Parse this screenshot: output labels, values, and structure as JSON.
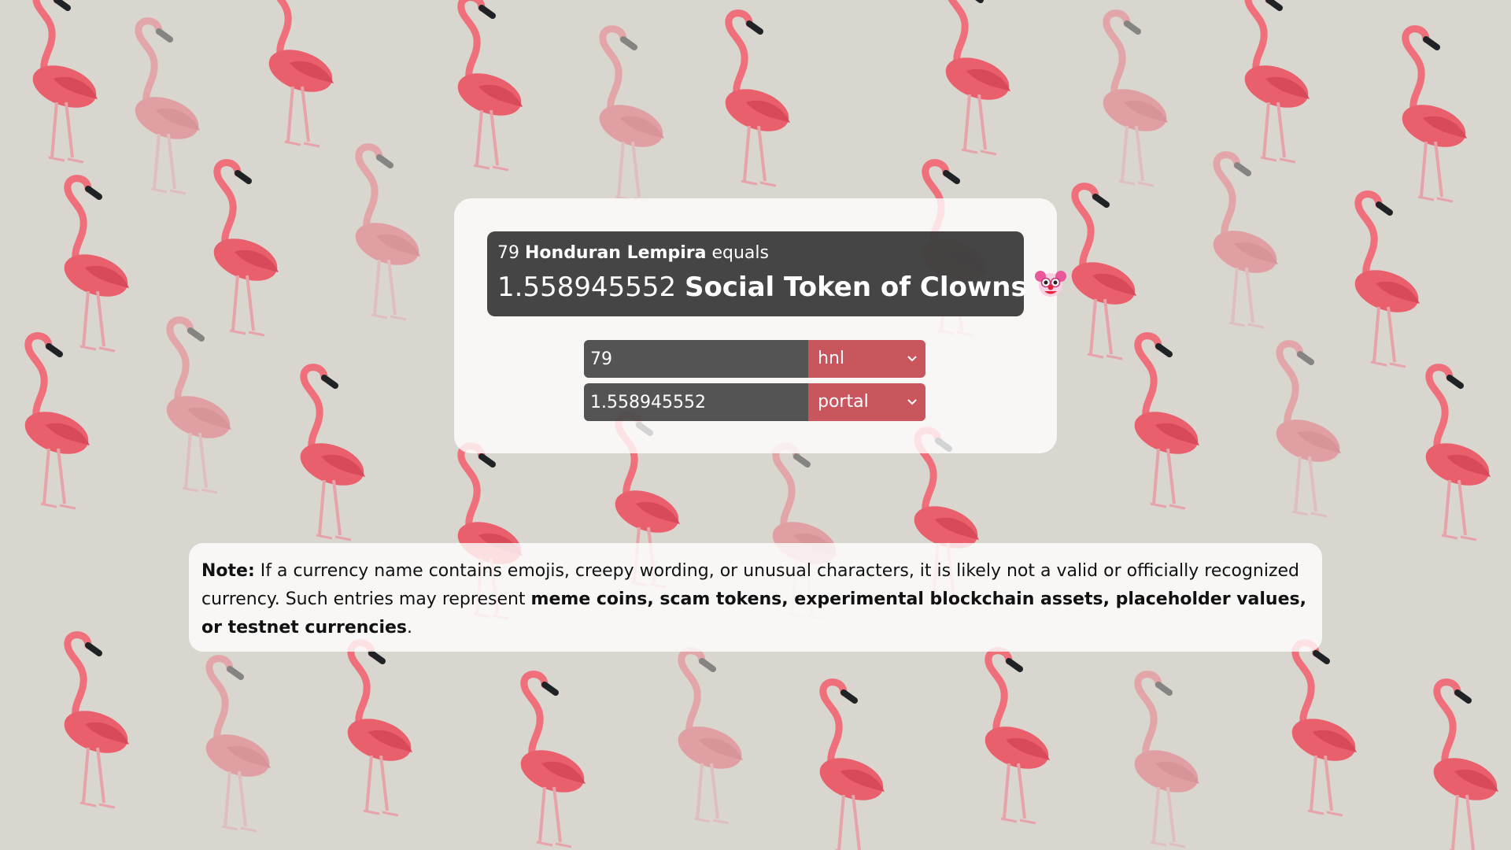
{
  "result": {
    "from_amount": "79",
    "from_name": "Honduran Lempira",
    "equals_word": "equals",
    "to_amount": "1.558945552",
    "to_name": "Social Token of Clowns",
    "to_icon": "clown-face-icon"
  },
  "converter": {
    "from_value": "79",
    "from_currency": "hnl",
    "to_value": "1.558945552",
    "to_currency": "portal",
    "select_icon": "chevron-down-icon"
  },
  "note": {
    "label": "Note:",
    "text_1": " If a currency name contains emojis, creepy wording, or unusual characters, it is likely not a valid or officially recognized currency. Such entries may represent ",
    "bold_list": "meme coins, scam tokens, experimental blockchain assets, placeholder values, or testnet currencies",
    "text_end": "."
  },
  "colors": {
    "select_bg": "#c9555d",
    "input_bg": "#303030",
    "result_bg": "#282828",
    "flamingo": "#e8606a",
    "background": "#d9d5cf"
  }
}
